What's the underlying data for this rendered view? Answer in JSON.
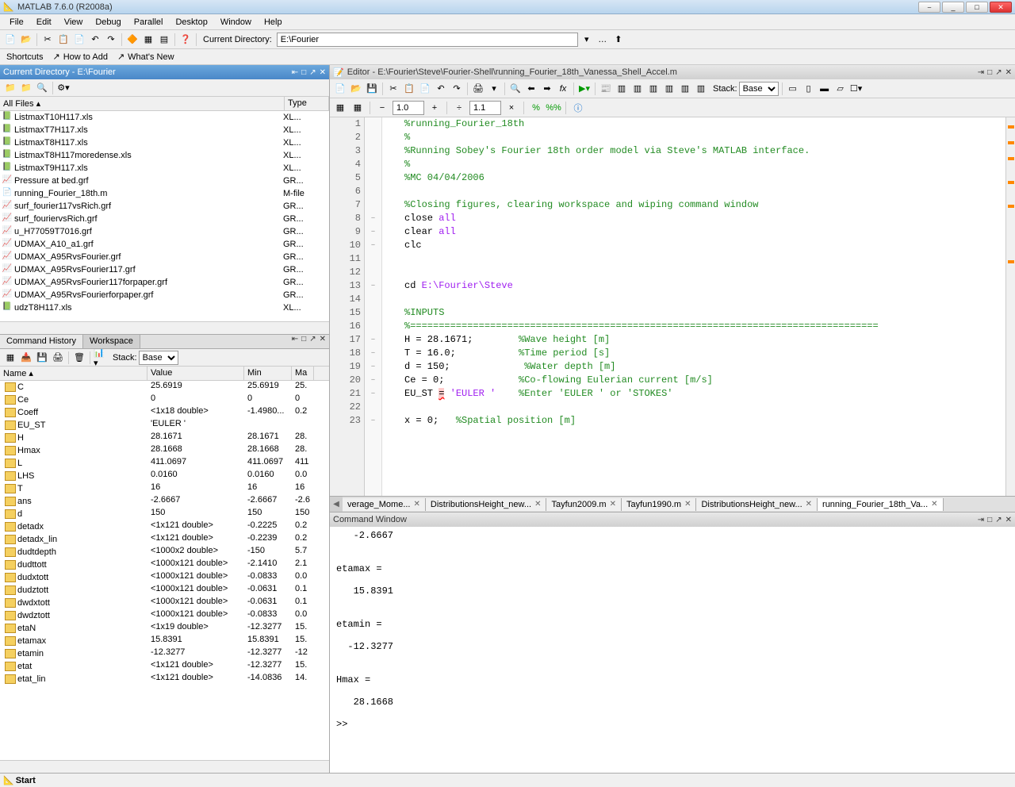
{
  "title": "MATLAB 7.6.0 (R2008a)",
  "menubar": [
    "File",
    "Edit",
    "View",
    "Debug",
    "Parallel",
    "Desktop",
    "Window",
    "Help"
  ],
  "toolbar": {
    "current_directory_label": "Current Directory:",
    "current_directory_value": "E:\\Fourier"
  },
  "shortcuts": {
    "label": "Shortcuts",
    "how_to_add": "How to Add",
    "whats_new": "What's New"
  },
  "current_dir_panel": {
    "title": "Current Directory - E:\\Fourier",
    "header_name": "All Files",
    "header_type": "Type",
    "files": [
      {
        "name": "ListmaxT10H117.xls",
        "type": "XL..."
      },
      {
        "name": "ListmaxT7H117.xls",
        "type": "XL..."
      },
      {
        "name": "ListmaxT8H117.xls",
        "type": "XL..."
      },
      {
        "name": "ListmaxT8H117moredense.xls",
        "type": "XL..."
      },
      {
        "name": "ListmaxT9H117.xls",
        "type": "XL..."
      },
      {
        "name": "Pressure at bed.grf",
        "type": "GR..."
      },
      {
        "name": "running_Fourier_18th.m",
        "type": "M-file"
      },
      {
        "name": "surf_fourier117vsRich.grf",
        "type": "GR..."
      },
      {
        "name": "surf_fouriervsRich.grf",
        "type": "GR..."
      },
      {
        "name": "u_H77059T7016.grf",
        "type": "GR..."
      },
      {
        "name": "UDMAX_A10_a1.grf",
        "type": "GR..."
      },
      {
        "name": "UDMAX_A95RvsFourier.grf",
        "type": "GR..."
      },
      {
        "name": "UDMAX_A95RvsFourier117.grf",
        "type": "GR..."
      },
      {
        "name": "UDMAX_A95RvsFourier117forpaper.grf",
        "type": "GR..."
      },
      {
        "name": "UDMAX_A95RvsFourierforpaper.grf",
        "type": "GR..."
      },
      {
        "name": "udzT8H117.xls",
        "type": "XL..."
      }
    ]
  },
  "ws_tabs": {
    "cmd_history": "Command History",
    "workspace": "Workspace"
  },
  "workspace": {
    "stack_label": "Stack:",
    "stack_value": "Base",
    "headers": {
      "name": "Name",
      "value": "Value",
      "min": "Min",
      "max": "Ma"
    },
    "vars": [
      {
        "name": "C",
        "value": "25.6919",
        "min": "25.6919",
        "max": "25."
      },
      {
        "name": "Ce",
        "value": "0",
        "min": "0",
        "max": "0"
      },
      {
        "name": "Coeff",
        "value": "<1x18 double>",
        "min": "-1.4980...",
        "max": "0.2"
      },
      {
        "name": "EU_ST",
        "value": "'EULER '",
        "min": "",
        "max": ""
      },
      {
        "name": "H",
        "value": "28.1671",
        "min": "28.1671",
        "max": "28."
      },
      {
        "name": "Hmax",
        "value": "28.1668",
        "min": "28.1668",
        "max": "28."
      },
      {
        "name": "L",
        "value": "411.0697",
        "min": "411.0697",
        "max": "411"
      },
      {
        "name": "LHS",
        "value": "0.0160",
        "min": "0.0160",
        "max": "0.0"
      },
      {
        "name": "T",
        "value": "16",
        "min": "16",
        "max": "16"
      },
      {
        "name": "ans",
        "value": "-2.6667",
        "min": "-2.6667",
        "max": "-2.6"
      },
      {
        "name": "d",
        "value": "150",
        "min": "150",
        "max": "150"
      },
      {
        "name": "detadx",
        "value": "<1x121 double>",
        "min": "-0.2225",
        "max": "0.2"
      },
      {
        "name": "detadx_lin",
        "value": "<1x121 double>",
        "min": "-0.2239",
        "max": "0.2"
      },
      {
        "name": "dudtdepth",
        "value": "<1000x2 double>",
        "min": "-150",
        "max": "5.7"
      },
      {
        "name": "dudttott",
        "value": "<1000x121 double>",
        "min": "-2.1410",
        "max": "2.1"
      },
      {
        "name": "dudxtott",
        "value": "<1000x121 double>",
        "min": "-0.0833",
        "max": "0.0"
      },
      {
        "name": "dudztott",
        "value": "<1000x121 double>",
        "min": "-0.0631",
        "max": "0.1"
      },
      {
        "name": "dwdxtott",
        "value": "<1000x121 double>",
        "min": "-0.0631",
        "max": "0.1"
      },
      {
        "name": "dwdztott",
        "value": "<1000x121 double>",
        "min": "-0.0833",
        "max": "0.0"
      },
      {
        "name": "etaN",
        "value": "<1x19 double>",
        "min": "-12.3277",
        "max": "15."
      },
      {
        "name": "etamax",
        "value": "15.8391",
        "min": "15.8391",
        "max": "15."
      },
      {
        "name": "etamin",
        "value": "-12.3277",
        "min": "-12.3277",
        "max": "-12"
      },
      {
        "name": "etat",
        "value": "<1x121 double>",
        "min": "-12.3277",
        "max": "15."
      },
      {
        "name": "etat_lin",
        "value": "<1x121 double>",
        "min": "-14.0836",
        "max": "14."
      }
    ]
  },
  "editor": {
    "title": "Editor - E:\\Fourier\\Steve\\Fourier-Shell\\running_Fourier_18th_Vanessa_Shell_Accel.m",
    "stack_label": "Stack:",
    "stack_value": "Base",
    "zoom1": "1.0",
    "zoom2": "1.1",
    "code": [
      {
        "n": 1,
        "t": "comment",
        "txt": "%running_Fourier_18th"
      },
      {
        "n": 2,
        "t": "comment",
        "txt": "%"
      },
      {
        "n": 3,
        "t": "comment",
        "txt": "%Running Sobey's Fourier 18th order model via Steve's MATLAB interface."
      },
      {
        "n": 4,
        "t": "comment",
        "txt": "%"
      },
      {
        "n": 5,
        "t": "comment",
        "txt": "%MC 04/04/2006"
      },
      {
        "n": 6,
        "t": "",
        "txt": ""
      },
      {
        "n": 7,
        "t": "comment",
        "txt": "%Closing figures, clearing workspace and wiping command window"
      },
      {
        "n": 8,
        "t": "stmt",
        "txt": "close ",
        "kw": "all",
        "dash": true
      },
      {
        "n": 9,
        "t": "stmt",
        "txt": "clear ",
        "kw": "all",
        "dash": true
      },
      {
        "n": 10,
        "t": "plain",
        "txt": "clc",
        "dash": true
      },
      {
        "n": 11,
        "t": "",
        "txt": ""
      },
      {
        "n": 12,
        "t": "",
        "txt": ""
      },
      {
        "n": 13,
        "t": "cd",
        "txt": "cd ",
        "path": "E:\\Fourier\\Steve",
        "dash": true
      },
      {
        "n": 14,
        "t": "",
        "txt": ""
      },
      {
        "n": 15,
        "t": "comment",
        "txt": "%INPUTS"
      },
      {
        "n": 16,
        "t": "comment",
        "txt": "%=================================================================================="
      },
      {
        "n": 17,
        "t": "assign",
        "txt": "H = 28.1671;        ",
        "c": "%Wave height [m]",
        "dash": true
      },
      {
        "n": 18,
        "t": "assign",
        "txt": "T = 16.0;           ",
        "c": "%Time period [s]",
        "dash": true
      },
      {
        "n": 19,
        "t": "assign",
        "txt": "d = 150;             ",
        "c": "%Water depth [m]",
        "dash": true
      },
      {
        "n": 20,
        "t": "assign",
        "txt": "Ce = 0;             ",
        "c": "%Co-flowing Eulerian current [m/s]",
        "dash": true
      },
      {
        "n": 21,
        "t": "eustr",
        "pre": "EU_ST ",
        "err": "=",
        "str": " 'EULER '    ",
        "c": "%Enter 'EULER ' or 'STOKES'",
        "dash": true
      },
      {
        "n": 22,
        "t": "",
        "txt": ""
      },
      {
        "n": 23,
        "t": "assign",
        "txt": "x = 0;   ",
        "c": "%Spatial position [m]",
        "dash": true
      }
    ],
    "tabs": [
      {
        "label": "verage_Mome...",
        "active": false
      },
      {
        "label": "DistributionsHeight_new...",
        "active": false
      },
      {
        "label": "Tayfun2009.m",
        "active": false
      },
      {
        "label": "Tayfun1990.m",
        "active": false
      },
      {
        "label": "DistributionsHeight_new...",
        "active": false
      },
      {
        "label": "running_Fourier_18th_Va...",
        "active": true
      }
    ]
  },
  "cmd_window": {
    "title": "Command Window",
    "content": "   -2.6667\n\n\netamax =\n\n   15.8391\n\n\netamin =\n\n  -12.3277\n\n\nHmax =\n\n   28.1668\n\n>> "
  },
  "statusbar": {
    "start": "Start"
  }
}
